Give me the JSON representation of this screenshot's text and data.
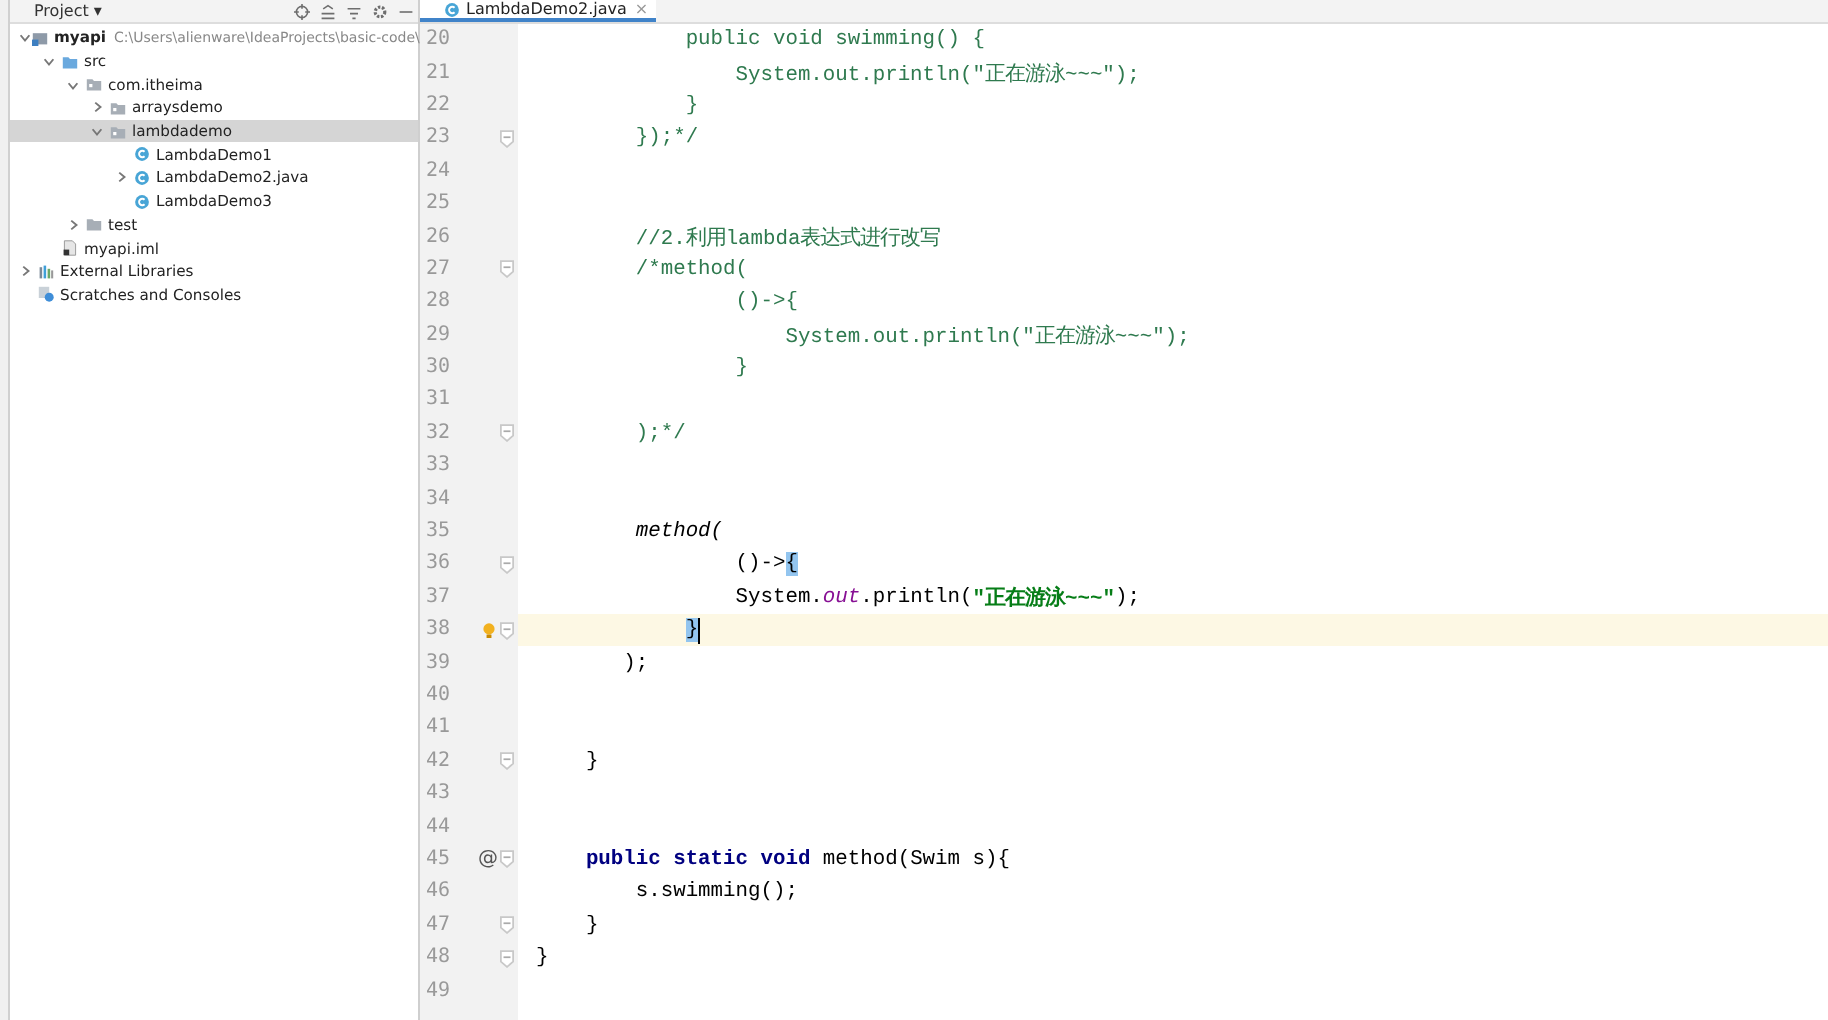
{
  "project_panel": {
    "title": "Project",
    "dropdown": "▾",
    "tree": [
      {
        "label": "myapi",
        "path": "C:\\Users\\alienware\\IdeaProjects\\basic-code\\",
        "kind": "module",
        "expanded": true,
        "selected": false,
        "bold": true,
        "children": [
          {
            "label": "src",
            "kind": "source-folder",
            "expanded": true,
            "selected": false,
            "children": [
              {
                "label": "com.itheima",
                "kind": "package",
                "expanded": true,
                "selected": false,
                "children": [
                  {
                    "label": "arraysdemo",
                    "kind": "package",
                    "expanded": false,
                    "selected": false
                  },
                  {
                    "label": "lambdademo",
                    "kind": "package",
                    "expanded": true,
                    "selected": true,
                    "children": [
                      {
                        "label": "LambdaDemo1",
                        "kind": "class",
                        "selected": false
                      },
                      {
                        "label": "LambdaDemo2.java",
                        "kind": "class",
                        "expanded": false,
                        "selected": false
                      },
                      {
                        "label": "LambdaDemo3",
                        "kind": "class",
                        "selected": false
                      }
                    ]
                  }
                ]
              },
              {
                "label": "test",
                "kind": "folder",
                "expanded": false,
                "selected": false
              }
            ]
          },
          {
            "label": "myapi.iml",
            "kind": "file",
            "selected": false
          }
        ]
      },
      {
        "label": "External Libraries",
        "kind": "libraries",
        "expanded": false,
        "selected": false
      },
      {
        "label": "Scratches and Consoles",
        "kind": "scratches",
        "selected": false
      }
    ]
  },
  "editor": {
    "tab": {
      "label": "LambdaDemo2.java",
      "close": "×"
    },
    "lines": [
      {
        "num": "20",
        "tokens": [
          {
            "text": "            public void swimming() {",
            "kind": "comment"
          }
        ]
      },
      {
        "num": "21",
        "tokens": [
          {
            "text": "                System.out.println(\"正在游泳~~~\");",
            "kind": "comment"
          }
        ]
      },
      {
        "num": "22",
        "tokens": [
          {
            "text": "            }",
            "kind": "comment"
          }
        ]
      },
      {
        "num": "23",
        "fold": true,
        "tokens": [
          {
            "text": "        });*/",
            "kind": "comment"
          }
        ]
      },
      {
        "num": "24"
      },
      {
        "num": "25"
      },
      {
        "num": "26",
        "tokens": [
          {
            "text": "        //2.利用lambda表达式进行改写",
            "kind": "comment"
          }
        ]
      },
      {
        "num": "27",
        "fold": true,
        "tokens": [
          {
            "text": "        /*method(",
            "kind": "comment"
          }
        ]
      },
      {
        "num": "28",
        "tokens": [
          {
            "text": "                ()->{",
            "kind": "comment"
          }
        ]
      },
      {
        "num": "29",
        "tokens": [
          {
            "text": "                    System.out.println(\"正在游泳~~~\");",
            "kind": "comment"
          }
        ]
      },
      {
        "num": "30",
        "tokens": [
          {
            "text": "                }",
            "kind": "comment"
          }
        ]
      },
      {
        "num": "31"
      },
      {
        "num": "32",
        "fold": true,
        "tokens": [
          {
            "text": "        );*/",
            "kind": "comment"
          }
        ]
      },
      {
        "num": "33"
      },
      {
        "num": "34"
      },
      {
        "num": "35",
        "tokens": [
          {
            "text": "        method(",
            "kind": "italic"
          }
        ]
      },
      {
        "num": "36",
        "fold": true,
        "tokens": [
          {
            "text": "                ()->{",
            "kind": "plain",
            "brace_match": true
          }
        ]
      },
      {
        "num": "37",
        "tokens": [
          {
            "text": "                System.",
            "kind": "plain"
          },
          {
            "text": "out",
            "kind": "field"
          },
          {
            "text": ".println(",
            "kind": "plain"
          },
          {
            "text": "\"正在游泳~~~\"",
            "kind": "string"
          },
          {
            "text": ");",
            "kind": "plain"
          }
        ]
      },
      {
        "num": "38",
        "fold": true,
        "bulb": true,
        "current": true,
        "caret": true,
        "tokens": [
          {
            "text": "            }",
            "kind": "plain",
            "brace_match": true
          }
        ]
      },
      {
        "num": "39",
        "tokens": [
          {
            "text": "       );",
            "kind": "plain"
          }
        ]
      },
      {
        "num": "40"
      },
      {
        "num": "41"
      },
      {
        "num": "42",
        "fold": true,
        "tokens": [
          {
            "text": "    }",
            "kind": "plain"
          }
        ]
      },
      {
        "num": "43"
      },
      {
        "num": "44"
      },
      {
        "num": "45",
        "fold": true,
        "gutter_text": "@",
        "tokens": [
          {
            "text": "    public static void",
            "kind": "keyword"
          },
          {
            "text": " method(Swim s){",
            "kind": "plain"
          }
        ]
      },
      {
        "num": "46",
        "tokens": [
          {
            "text": "        s.swimming();",
            "kind": "plain"
          }
        ]
      },
      {
        "num": "47",
        "fold": true,
        "tokens": [
          {
            "text": "    }",
            "kind": "plain"
          }
        ]
      },
      {
        "num": "48",
        "fold": true,
        "tokens": [
          {
            "text": "}",
            "kind": "plain"
          }
        ]
      },
      {
        "num": "49"
      }
    ]
  }
}
